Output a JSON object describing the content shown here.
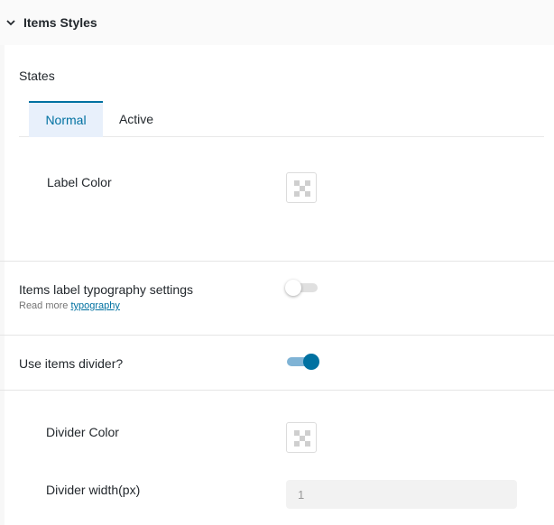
{
  "panel": {
    "title": "Items Styles"
  },
  "states": {
    "label": "States",
    "tabs": [
      {
        "label": "Normal",
        "selected": true
      },
      {
        "label": "Active",
        "selected": false
      }
    ]
  },
  "label_color": {
    "label": "Label Color"
  },
  "typography": {
    "label": "Items label typography settings",
    "read_more": "Read more",
    "link": "typography",
    "enabled": false
  },
  "divider_toggle": {
    "label": "Use items divider?",
    "enabled": true
  },
  "divider_color": {
    "label": "Divider Color"
  },
  "divider_width": {
    "label": "Divider width(px)",
    "value": "1"
  },
  "colors": {
    "accent": "#0071a1",
    "tab_bg": "#e8f0fb",
    "toggle_track_on": "#7fb3d5"
  }
}
